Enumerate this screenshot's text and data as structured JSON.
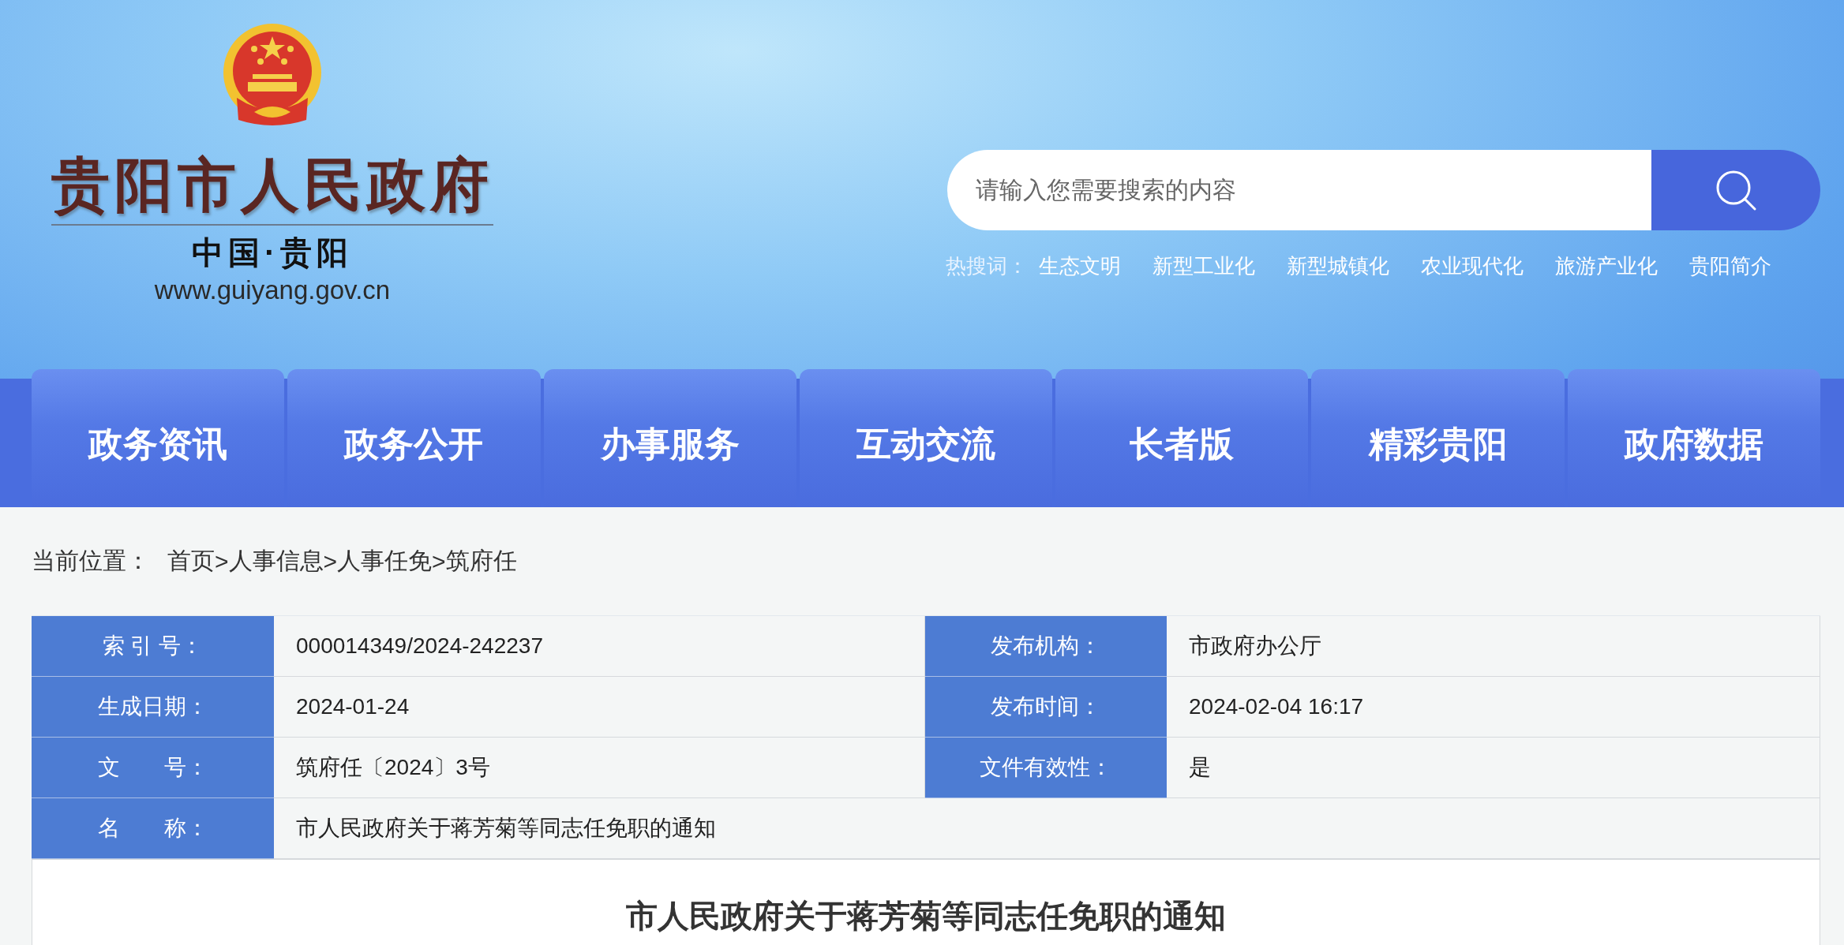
{
  "header": {
    "site_title": "贵阳市人民政府",
    "subtitle": "中国·贵阳",
    "url": "www.guiyang.gov.cn",
    "search": {
      "placeholder": "请输入您需要搜索的内容"
    },
    "hot_label": "热搜词：",
    "hot_words": [
      "生态文明",
      "新型工业化",
      "新型城镇化",
      "农业现代化",
      "旅游产业化",
      "贵阳简介"
    ]
  },
  "nav": [
    {
      "label": "政务资讯"
    },
    {
      "label": "政务公开"
    },
    {
      "label": "办事服务"
    },
    {
      "label": "互动交流"
    },
    {
      "label": "长者版"
    },
    {
      "label": "精彩贵阳"
    },
    {
      "label": "政府数据"
    }
  ],
  "breadcrumb": {
    "label": "当前位置：",
    "separator": ">",
    "items": [
      "首页",
      "人事信息",
      "人事任免",
      "筑府任"
    ]
  },
  "info_table": {
    "rows": [
      {
        "cells": [
          {
            "label": "索 引 号：",
            "value": "000014349/2024-242237"
          },
          {
            "label": "发布机构：",
            "value": "市政府办公厅"
          }
        ]
      },
      {
        "cells": [
          {
            "label": "生成日期：",
            "value": "2024-01-24"
          },
          {
            "label": "发布时间：",
            "value": "2024-02-04 16:17"
          }
        ]
      },
      {
        "cells": [
          {
            "label": "文　　号：",
            "value": "筑府任〔2024〕3号"
          },
          {
            "label": "文件有效性：",
            "value": "是"
          }
        ]
      },
      {
        "cells": [
          {
            "label": "名　　称：",
            "value": "市人民政府关于蒋芳菊等同志任免职的通知"
          }
        ]
      }
    ]
  },
  "article": {
    "title": "市人民政府关于蒋芳菊等同志任免职的通知"
  }
}
